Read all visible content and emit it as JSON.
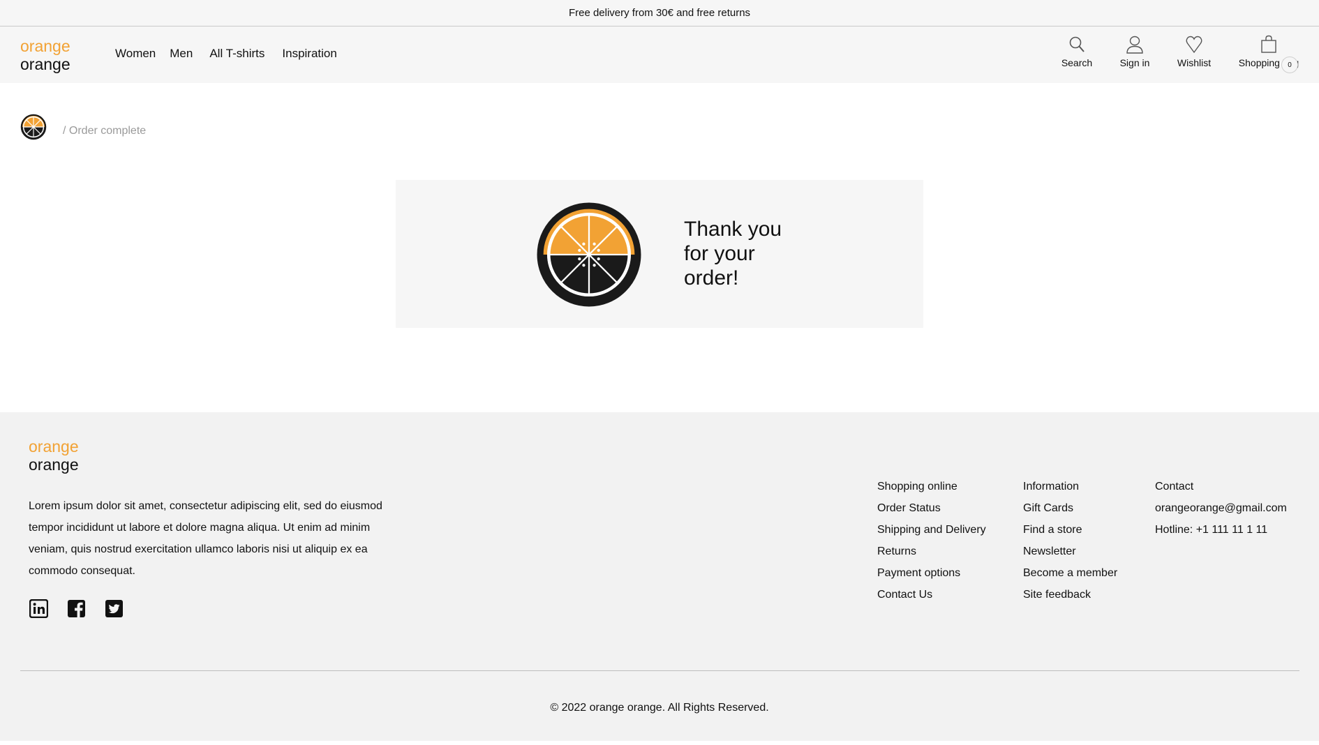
{
  "topbar": {
    "text": "Free delivery from 30€ and free returns"
  },
  "brand": {
    "line1": "orange",
    "line2": "orange",
    "accent": "#f2a234",
    "dark": "#111111"
  },
  "nav": {
    "items": [
      "Women",
      "Men",
      "All T-shirts",
      "Inspiration"
    ]
  },
  "tools": {
    "search": {
      "label": "Search",
      "icon": "search-icon"
    },
    "signin": {
      "label": "Sign in",
      "icon": "user-icon"
    },
    "wishlist": {
      "label": "Wishlist",
      "icon": "heart-icon"
    },
    "bag": {
      "label": "Shopping bag",
      "icon": "shopping-bag-icon",
      "count": "0"
    }
  },
  "breadcrumb": {
    "current": "/ Order complete",
    "home_icon": "orange-logo-icon"
  },
  "confirmation": {
    "line1": "Thank you",
    "line2": "for your",
    "line3": "order!"
  },
  "footer": {
    "description": "Lorem ipsum dolor sit amet, consectetur adipiscing elit, sed do eiusmod tempor incididunt ut labore et dolore magna aliqua. Ut enim ad minim veniam, quis nostrud exercitation ullamco laboris nisi ut aliquip ex ea commodo consequat.",
    "social": [
      "linkedin-icon",
      "facebook-icon",
      "twitter-icon"
    ],
    "col1": [
      "Shopping online",
      "Order Status",
      "Shipping and Delivery",
      "Returns",
      "Payment options",
      "Contact Us"
    ],
    "col2": [
      "Information",
      "Gift Cards",
      "Find a store",
      "Newsletter",
      "Become a member",
      "Site feedback"
    ],
    "col3": [
      "Contact",
      "orangeorange@gmail.com",
      "Hotline: +1 111 11 1 11"
    ],
    "copyright": "© 2022 orange orange. All Rights Reserved."
  }
}
